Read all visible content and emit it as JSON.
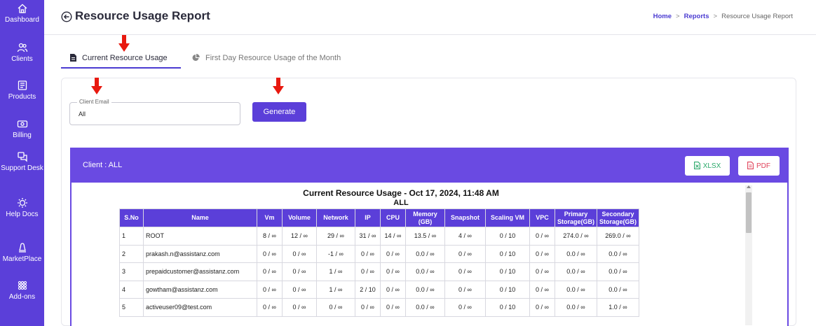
{
  "sidebar": {
    "items": [
      {
        "label": "Dashboard",
        "icon": "home-icon"
      },
      {
        "label": "Clients",
        "icon": "users-icon"
      },
      {
        "label": "Products",
        "icon": "products-icon"
      },
      {
        "label": "Billing",
        "icon": "billing-icon"
      },
      {
        "label": "Support Desk",
        "icon": "support-icon"
      },
      {
        "label": "Help Docs",
        "icon": "help-icon"
      },
      {
        "label": "MarketPlace",
        "icon": "marketplace-icon"
      },
      {
        "label": "Add-ons",
        "icon": "addons-icon"
      }
    ]
  },
  "header": {
    "title": "Resource Usage Report",
    "breadcrumb": {
      "home": "Home",
      "reports": "Reports",
      "current": "Resource Usage Report",
      "separator": ">"
    }
  },
  "tabs": [
    {
      "label": "Current Resource Usage",
      "active": true
    },
    {
      "label": "First Day Resource Usage of the Month",
      "active": false
    }
  ],
  "filter": {
    "field_label": "Client Email",
    "field_value": "All",
    "generate_label": "Generate"
  },
  "client_panel": {
    "label": "Client : ALL",
    "xlsx_label": "XLSX",
    "pdf_label": "PDF"
  },
  "report": {
    "title": "Current Resource Usage  - Oct 17, 2024, 11:48 AM",
    "subtitle": "ALL",
    "columns": [
      "S.No",
      "Name",
      "Vm",
      "Volume",
      "Network",
      "IP",
      "CPU",
      "Memory (GB)",
      "Snapshot",
      "Scaling VM",
      "VPC",
      "Primary Storage(GB)",
      "Secondary Storage(GB)"
    ],
    "rows": [
      [
        "1",
        "ROOT",
        "8 / ∞",
        "12 / ∞",
        "29 / ∞",
        "31 / ∞",
        "14 / ∞",
        "13.5 / ∞",
        "4 / ∞",
        "0 / 10",
        "0 / ∞",
        "274.0 / ∞",
        "269.0 / ∞"
      ],
      [
        "2",
        "prakash.n@assistanz.com",
        "0 / ∞",
        "0 / ∞",
        "-1 / ∞",
        "0 / ∞",
        "0 / ∞",
        "0.0 / ∞",
        "0 / ∞",
        "0 / 10",
        "0 / ∞",
        "0.0 / ∞",
        "0.0 / ∞"
      ],
      [
        "3",
        "prepaidcustomer@assistanz.com",
        "0 / ∞",
        "0 / ∞",
        "1 / ∞",
        "0 / ∞",
        "0 / ∞",
        "0.0 / ∞",
        "0 / ∞",
        "0 / 10",
        "0 / ∞",
        "0.0 / ∞",
        "0.0 / ∞"
      ],
      [
        "4",
        "gowtham@assistanz.com",
        "0 / ∞",
        "0 / ∞",
        "1 / ∞",
        "2 / 10",
        "0 / ∞",
        "0.0 / ∞",
        "0 / ∞",
        "0 / 10",
        "0 / ∞",
        "0.0 / ∞",
        "0.0 / ∞"
      ],
      [
        "5",
        "activeuser09@test.com",
        "0 / ∞",
        "0 / ∞",
        "0 / ∞",
        "0 / ∞",
        "0 / ∞",
        "0.0 / ∞",
        "0 / ∞",
        "0 / 10",
        "0 / ∞",
        "0.0 / ∞",
        "1.0 / ∞"
      ]
    ]
  },
  "colors": {
    "sidebar": "#5b3fd9",
    "accent": "#4a3bd1",
    "client_bar": "#6a4ae2",
    "annotation_arrow": "#e8190f"
  }
}
